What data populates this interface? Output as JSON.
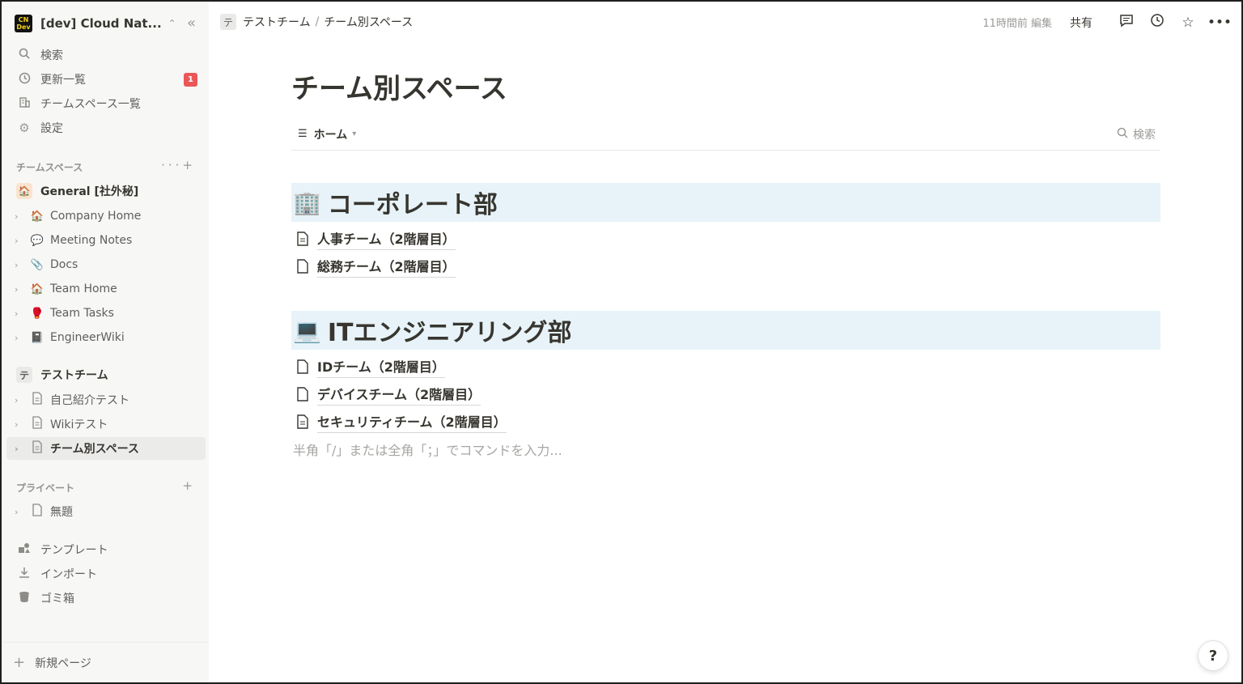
{
  "workspace": {
    "logo_top": "CN",
    "logo_bottom": "Dev",
    "name": "[dev] Cloud Nat..."
  },
  "nav": [
    {
      "label": "検索",
      "icon": "search-icon"
    },
    {
      "label": "更新一覧",
      "icon": "clock-icon",
      "badge": "1"
    },
    {
      "label": "チームスペース一覧",
      "icon": "building-icon"
    },
    {
      "label": "設定",
      "icon": "gear-icon"
    }
  ],
  "teamspace_section": {
    "label": "チームスペース"
  },
  "general": {
    "label": "General [社外秘]"
  },
  "general_items": [
    {
      "label": "Company Home",
      "emoji": "🏠"
    },
    {
      "label": "Meeting Notes",
      "emoji": "💬"
    },
    {
      "label": "Docs",
      "emoji": "📎"
    },
    {
      "label": "Team Home",
      "emoji": "🏠"
    },
    {
      "label": "Team Tasks",
      "emoji": "🥊"
    },
    {
      "label": "EngineerWiki",
      "emoji": "📓"
    }
  ],
  "test_team": {
    "badge": "テ",
    "label": "テストチーム"
  },
  "test_items": [
    {
      "label": "自己紹介テスト"
    },
    {
      "label": "Wikiテスト"
    },
    {
      "label": "チーム別スペース"
    }
  ],
  "private_section": {
    "label": "プライベート"
  },
  "private_items": [
    {
      "label": "無題"
    }
  ],
  "bottom_nav": [
    {
      "label": "テンプレート",
      "icon": "template-icon"
    },
    {
      "label": "インポート",
      "icon": "import-icon"
    },
    {
      "label": "ゴミ箱",
      "icon": "trash-icon"
    }
  ],
  "new_page": {
    "label": "新規ページ"
  },
  "breadcrumb": {
    "icon": "テ",
    "parent": "テストチーム",
    "separator": "/",
    "current": "チーム別スペース"
  },
  "topbar": {
    "edited": "11時間前 編集",
    "share": "共有"
  },
  "page": {
    "title": "チーム別スペース",
    "view_tab": "ホーム",
    "search": "検索",
    "sections": [
      {
        "emoji": "🏢",
        "heading": "コーポレート部",
        "items": [
          "人事チーム（2階層目）",
          "総務チーム（2階層目）"
        ]
      },
      {
        "emoji": "💻",
        "heading": "ITエンジニアリング部",
        "items": [
          "IDチーム（2階層目）",
          "デバイスチーム（2階層目）",
          "セキュリティチーム（2階層目）"
        ]
      }
    ],
    "placeholder": "半角「/」または全角「；」でコマンドを入力..."
  },
  "help": {
    "label": "?"
  },
  "colors": {
    "sidebar_bg": "#f7f7f5",
    "heading_bg": "#e7f3f8",
    "badge": "#eb5757"
  }
}
